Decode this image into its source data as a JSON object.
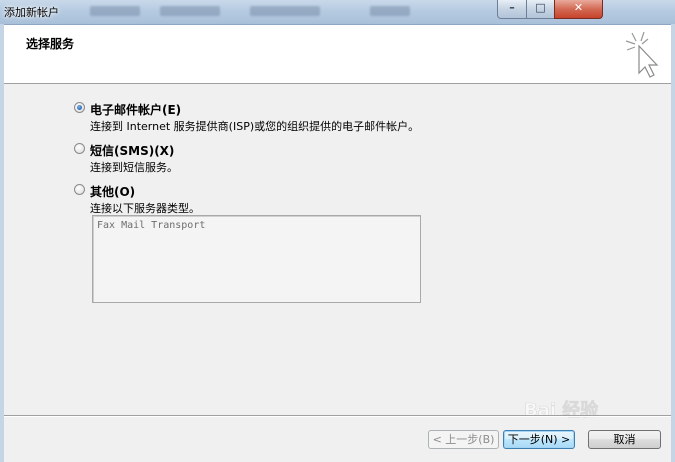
{
  "window": {
    "title": "添加新帐户"
  },
  "header": {
    "title": "选择服务"
  },
  "options": [
    {
      "label": "电子邮件帐户(E)",
      "description": "连接到 Internet 服务提供商(ISP)或您的组织提供的电子邮件帐户。",
      "selected": true
    },
    {
      "label": "短信(SMS)(X)",
      "description": "连接到短信服务。",
      "selected": false
    },
    {
      "label": "其他(O)",
      "description": "连接以下服务器类型。",
      "selected": false
    }
  ],
  "other_server_types": [
    "Fax Mail Transport"
  ],
  "footer": {
    "back_label": "< 上一步(B)",
    "next_label": "下一步(N) >",
    "cancel_label": "取消"
  },
  "watermark": {
    "text": "Bai 经验"
  },
  "colors": {
    "header_bg": "#ffffff",
    "dialog_bg": "#f0f0f0",
    "default_button_border": "#3c7fb1",
    "radio_selected": "#1f5fa8"
  },
  "icons": {
    "header": "cursor-sparkle-icon",
    "radio_selected": "radio-selected-icon",
    "radio_unselected": "radio-unselected-icon"
  }
}
